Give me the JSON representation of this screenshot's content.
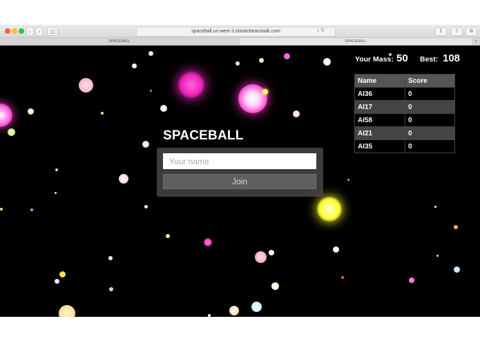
{
  "browser": {
    "url": "spaceball.us-west-2.elasticbeanstalk.com",
    "tabs": [
      {
        "label": "SPACEBALL"
      },
      {
        "label": "SPACEBALL"
      }
    ]
  },
  "stats": {
    "mass_label": "Your Mass:",
    "mass_value": "50",
    "best_label": "Best:",
    "best_value": "108"
  },
  "leaderboard": {
    "headers": [
      "Name",
      "Score"
    ],
    "rows": [
      {
        "name": "AI36",
        "score": "0"
      },
      {
        "name": "AI17",
        "score": "0"
      },
      {
        "name": "AI58",
        "score": "0"
      },
      {
        "name": "AI21",
        "score": "0"
      },
      {
        "name": "AI35",
        "score": "0"
      }
    ]
  },
  "login": {
    "title": "SPACEBALL",
    "name_placeholder": "Your name",
    "name_value": "",
    "join_label": "Join"
  },
  "colors": {
    "background": "#000000",
    "panel": "#464646",
    "button": "#5f5f5f",
    "magenta_ball": "#ff33cc",
    "yellow_ball": "#ffff33"
  }
}
